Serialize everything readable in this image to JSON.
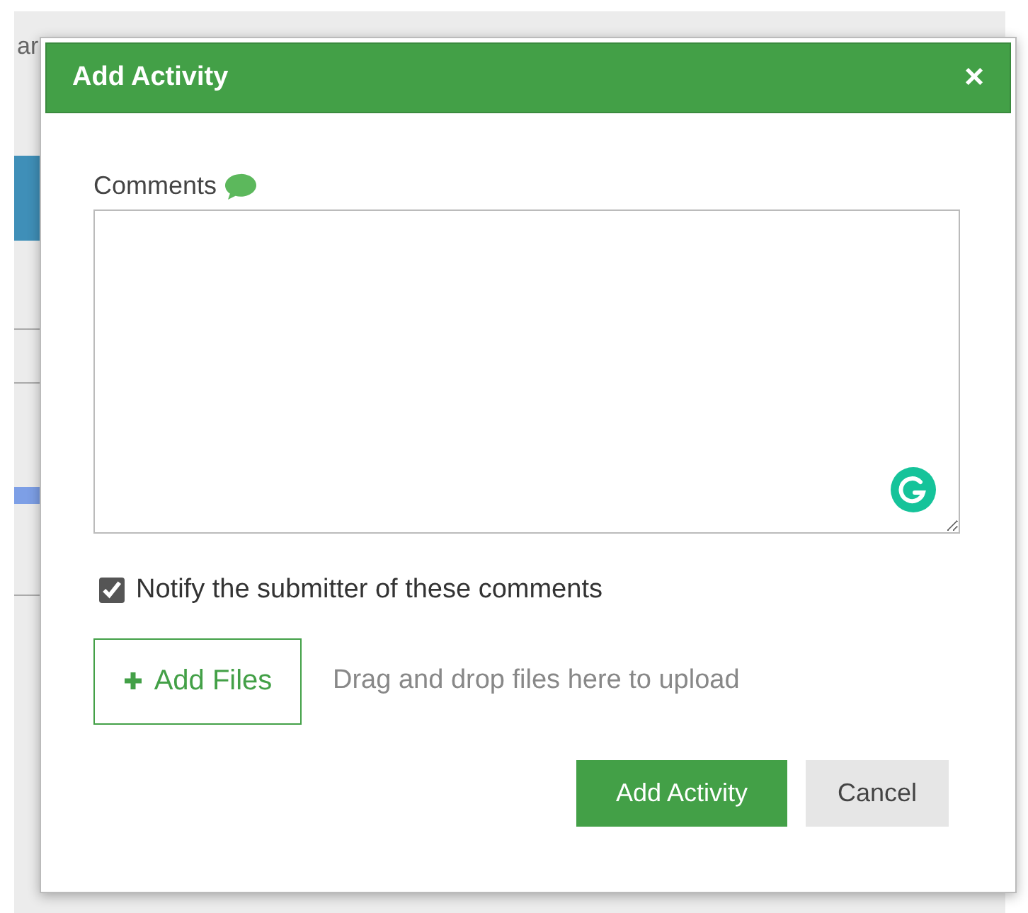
{
  "background": {
    "text": "ar"
  },
  "dialog": {
    "title": "Add Activity",
    "close": "×",
    "comments": {
      "label": "Comments"
    },
    "notify": {
      "label": "Notify the submitter of these comments",
      "checked": true
    },
    "add_files": {
      "label": "Add Files",
      "hint": "Drag and drop files here to upload"
    },
    "buttons": [
      {
        "kind": "primary",
        "label": "Add Activity"
      },
      {
        "kind": "secondary",
        "label": "Cancel"
      }
    ]
  }
}
